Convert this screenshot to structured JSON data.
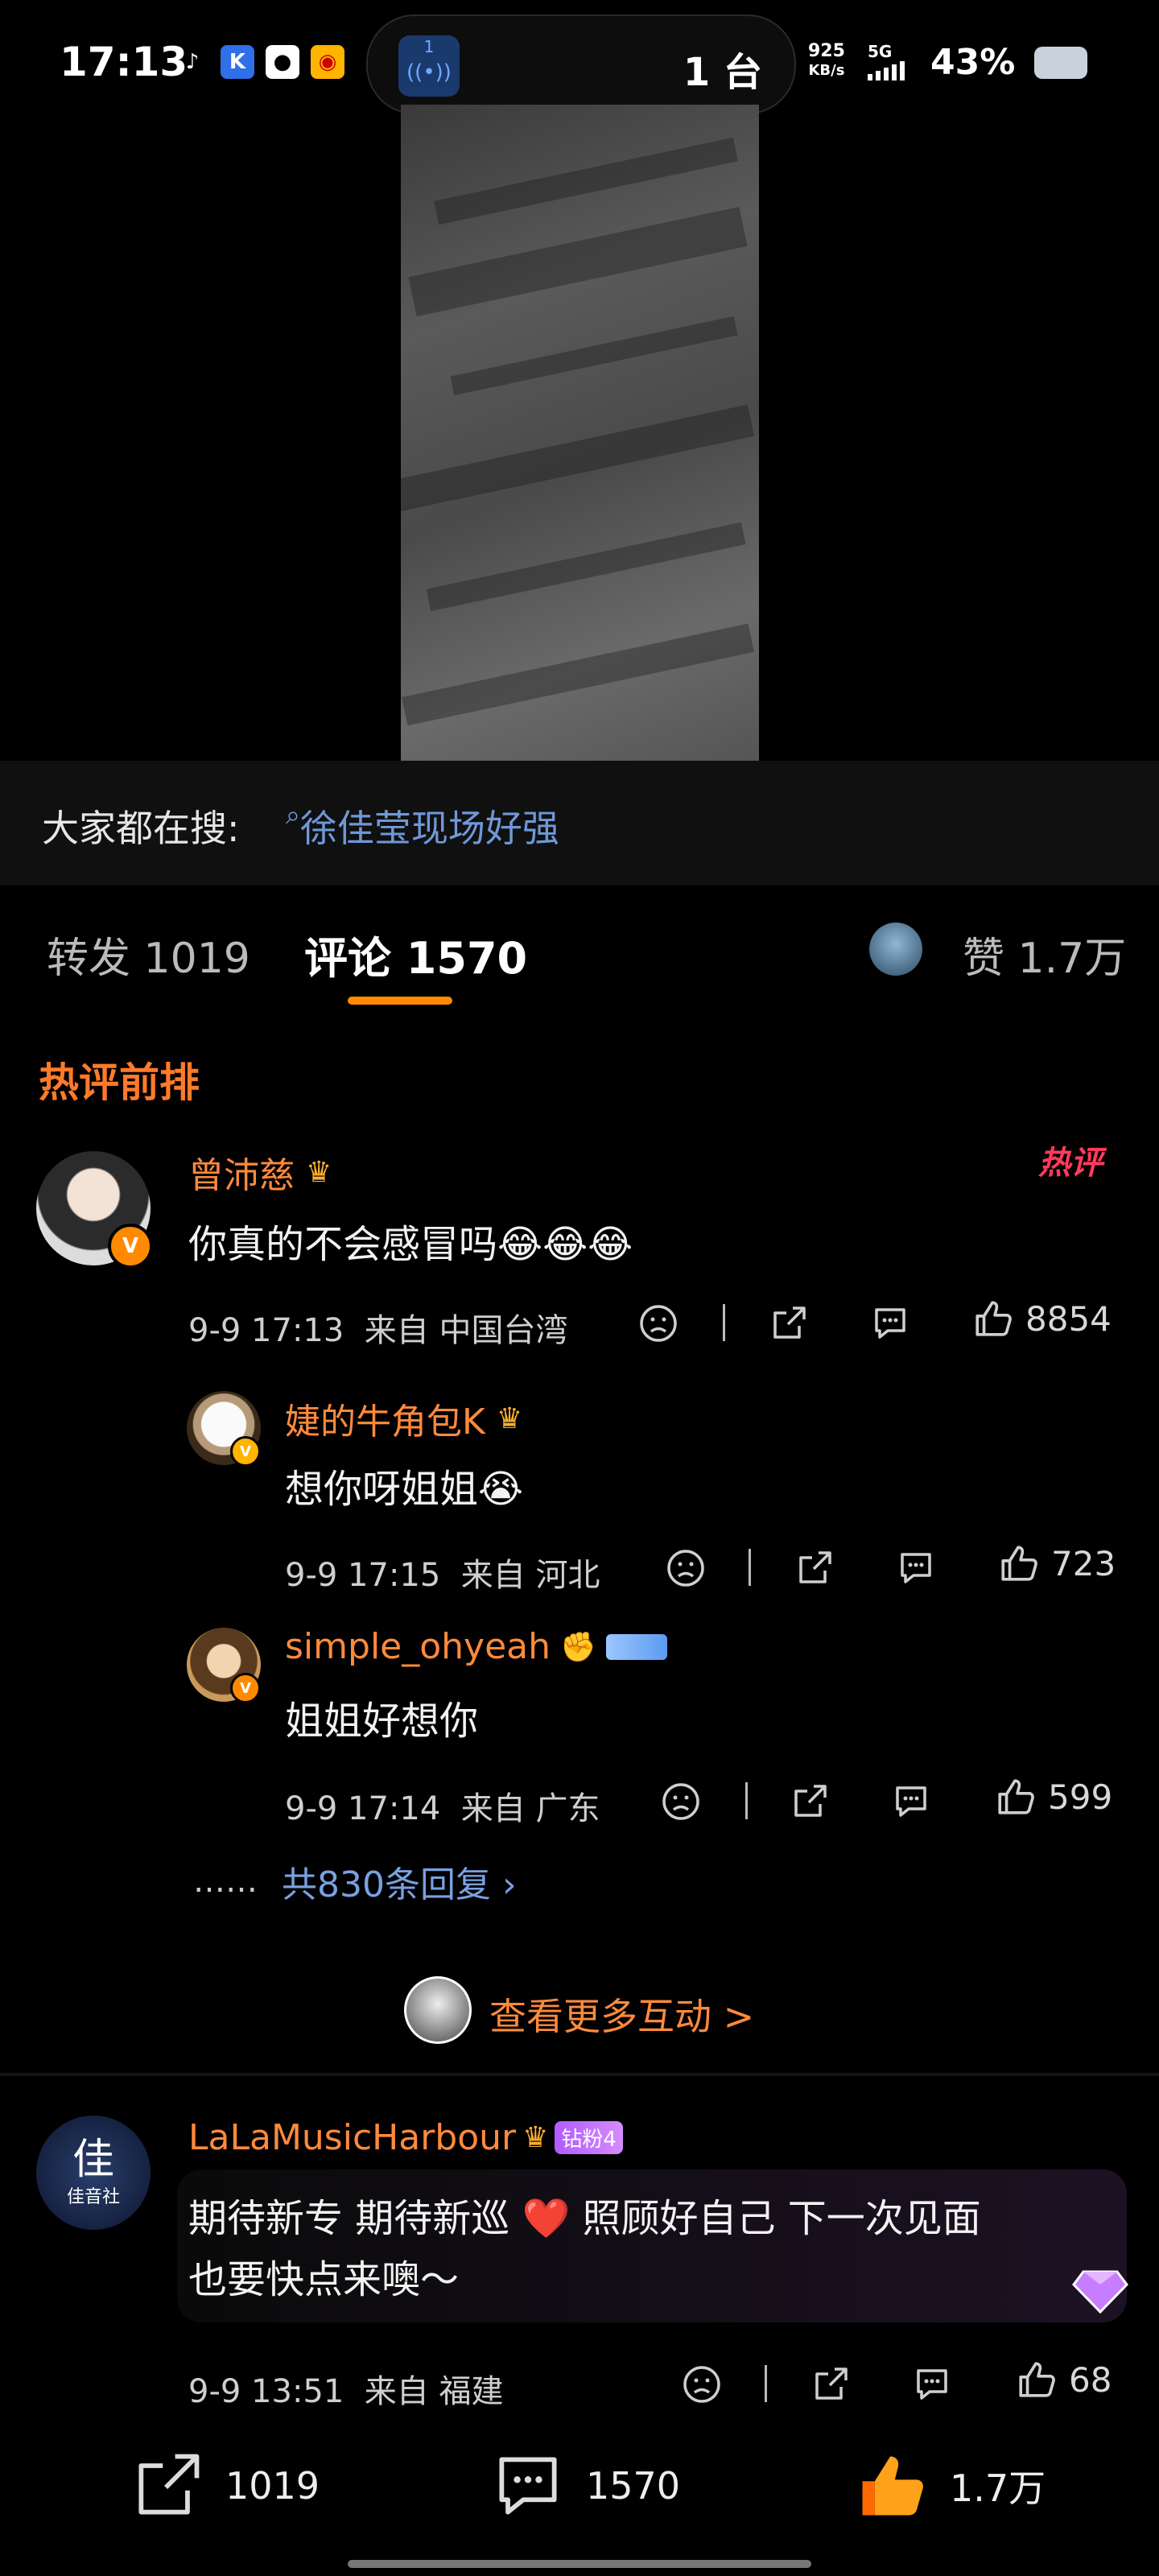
{
  "status_bar": {
    "time": "17:13",
    "app_icons": [
      "tiktok-icon",
      "k-app-icon",
      "qq-icon",
      "weibo-icon"
    ],
    "island_badge": "1",
    "island_text": "1 台",
    "net_speed_value": "925",
    "net_speed_unit": "KB/s",
    "network": "5G",
    "battery_percent": "43%"
  },
  "search_band": {
    "label": "大家都在搜:",
    "query": "徐佳莹现场好强"
  },
  "tabs": {
    "repost": "转发 1019",
    "comment": "评论 1570",
    "like": "赞 1.7万"
  },
  "section_title": "热评前排",
  "hot_tag": "热评",
  "comments": [
    {
      "user": "曾沛慈",
      "text": "你真的不会感冒吗😂😂😂",
      "time": "9-9 17:13",
      "location": "来自 中国台湾",
      "likes": "8854"
    }
  ],
  "replies": [
    {
      "user": "婕的牛角包K",
      "text": "想你呀姐姐😭",
      "time": "9-9 17:15",
      "location": "来自 河北",
      "likes": "723"
    },
    {
      "user": "simple_ohyeah",
      "text": "姐姐好想你",
      "time": "9-9 17:14",
      "location": "来自 广东",
      "likes": "599"
    }
  ],
  "more_replies": {
    "dots": "……",
    "text": "共830条回复 ›"
  },
  "more_interactions": "查看更多互动 >",
  "second_comment": {
    "user": "LaLaMusicHarbour",
    "fan_badge": "钻粉4",
    "avatar_text": "佳音社",
    "text_line1": "期待新专 期待新巡 ❤️ 照顾好自己 下一次见面",
    "text_line2": "也要快点来噢～",
    "time": "9-9 13:51",
    "location": "来自 福建",
    "likes": "68"
  },
  "bottom_bar": {
    "repost_count": "1019",
    "comment_count": "1570",
    "like_count": "1.7万"
  },
  "colors": {
    "accent_orange": "#ff8a00",
    "link_blue": "#6f98d8",
    "background": "#000000"
  }
}
